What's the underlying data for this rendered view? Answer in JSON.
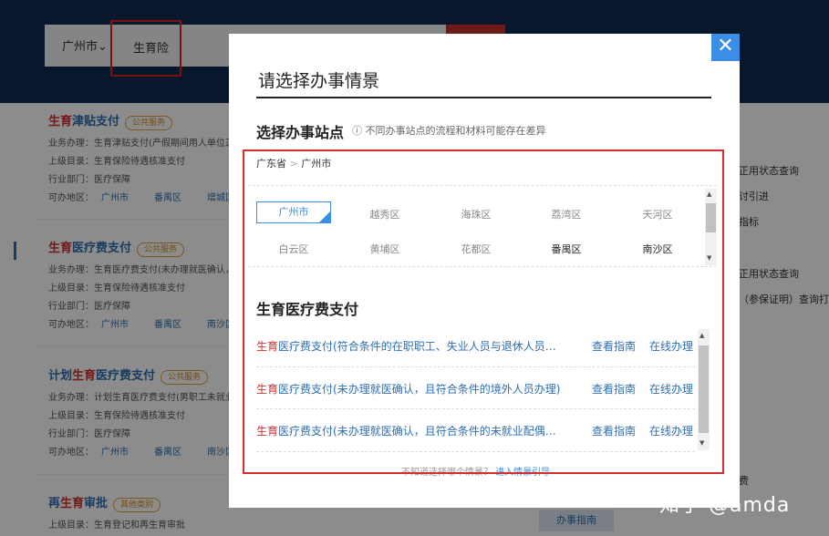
{
  "header": {
    "city": "广州市",
    "city_chevron": "⌄",
    "search_value": "生育险"
  },
  "bg_cards": [
    {
      "prefix": "",
      "red": "生育",
      "rest": "津贴支付",
      "badge": "公共服务",
      "rows": [
        "业务办理：生育津贴支付(产假期间用人单位正…",
        "上级目录：生育保险待遇核准支付",
        "行业部门：医疗保障"
      ],
      "area_label": "可办地区：",
      "areas": [
        "广州市",
        "番禺区",
        "增城区"
      ]
    },
    {
      "prefix": "",
      "red": "生育",
      "rest": "医疗费支付",
      "badge": "公共服务",
      "rows": [
        "业务办理：生育医疗费支付(未办理就医确认，…",
        "上级目录：生育保险待遇核准支付",
        "行业部门：医疗保障"
      ],
      "area_label": "可办地区：",
      "areas": [
        "广州市",
        "番禺区",
        "南沙区"
      ]
    },
    {
      "prefix": "计划",
      "red": "生育",
      "rest": "医疗费支付",
      "badge": "公共服务",
      "rows": [
        "业务办理：计划生育医疗费支付(男职工未就业…",
        "上级目录：生育保险待遇核准支付",
        "行业部门：医疗保障"
      ],
      "area_label": "可办地区：",
      "areas": [
        "广州市",
        "番禺区",
        "南沙区"
      ]
    },
    {
      "prefix": "再",
      "red": "生育",
      "rest": "审批",
      "badge": "其他类别",
      "rows": [
        "上级目录：生育登记和再生育审批"
      ]
    }
  ],
  "right_side": [
    "正用状态查询",
    "讨引进",
    "指标",
    "正用状态查询",
    "（参保证明）查询打",
    "费"
  ],
  "modal": {
    "close_symbol": "✕",
    "title": "请选择办事情景",
    "station_label": "选择办事站点",
    "station_tip": "不同办事站点的流程和材料可能存在差异",
    "info_icon": "ⓘ",
    "crumb": [
      "广东省",
      "广州市"
    ],
    "crumb_sep": ">",
    "districts": [
      "广州市",
      "越秀区",
      "海珠区",
      "荔湾区",
      "天河区",
      "白云区",
      "黄埔区",
      "花都区",
      "番禺区",
      "南沙区"
    ],
    "selected_district": "广州市",
    "section_title": "生育医疗费支付",
    "items": [
      {
        "red": "生育",
        "rest": "医疗费支付(符合条件的在职职工、失业人员与退休人员…",
        "guide": "查看指南",
        "online": "在线办理"
      },
      {
        "red": "生育",
        "rest": "医疗费支付(未办理就医确认，且符合条件的境外人员办理)",
        "guide": "查看指南",
        "online": "在线办理"
      },
      {
        "red": "生育",
        "rest": "医疗费支付(未办理就医确认，且符合条件的未就业配偶…",
        "guide": "查看指南",
        "online": "在线办理"
      }
    ],
    "bottom_tip": "不知道选择哪个情景？",
    "bottom_link": "进入情景引导",
    "scroll_up": "▲",
    "scroll_down": "▼"
  },
  "watermark": "知乎 @amda",
  "bottom_button": "办事指南",
  "colors": {
    "topbar": "#0f2a4f",
    "accent": "#3a8ee6",
    "highlight_red": "#d32f2f",
    "link": "#2f6fb0"
  }
}
